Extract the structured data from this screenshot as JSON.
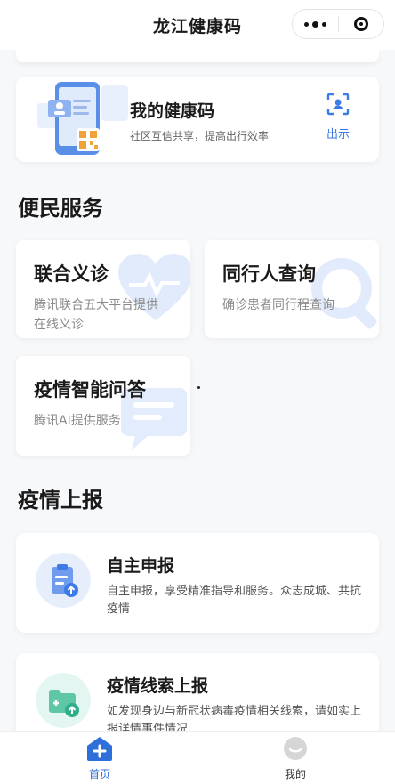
{
  "app": {
    "title": "龙江健康码"
  },
  "health_card": {
    "title": "我的健康码",
    "subtitle": "社区互信共享，提高出行效率",
    "action": "出示"
  },
  "sections": {
    "services": "便民服务",
    "report": "疫情上报"
  },
  "services": [
    {
      "title": "联合义诊",
      "desc_line1": "腾讯联合五大平台提供",
      "desc_line2": "在线义诊"
    },
    {
      "title": "同行人查询",
      "desc_line1": "确诊患者同行程查询"
    },
    {
      "title": "疫情智能问答",
      "desc_line1": "腾讯AI提供服务"
    }
  ],
  "reports": [
    {
      "title": "自主申报",
      "desc": "自主申报，享受精准指导和服务。众志成城、共抗疫情"
    },
    {
      "title": "疫情线索上报",
      "desc": "如发现身边与新冠状病毒疫情相关线索，请如实上报详情事件情况"
    }
  ],
  "tabs": {
    "home": "首页",
    "mine": "我的"
  },
  "colors": {
    "accent": "#3d7be6",
    "active_tab": "#2f6fd9"
  }
}
